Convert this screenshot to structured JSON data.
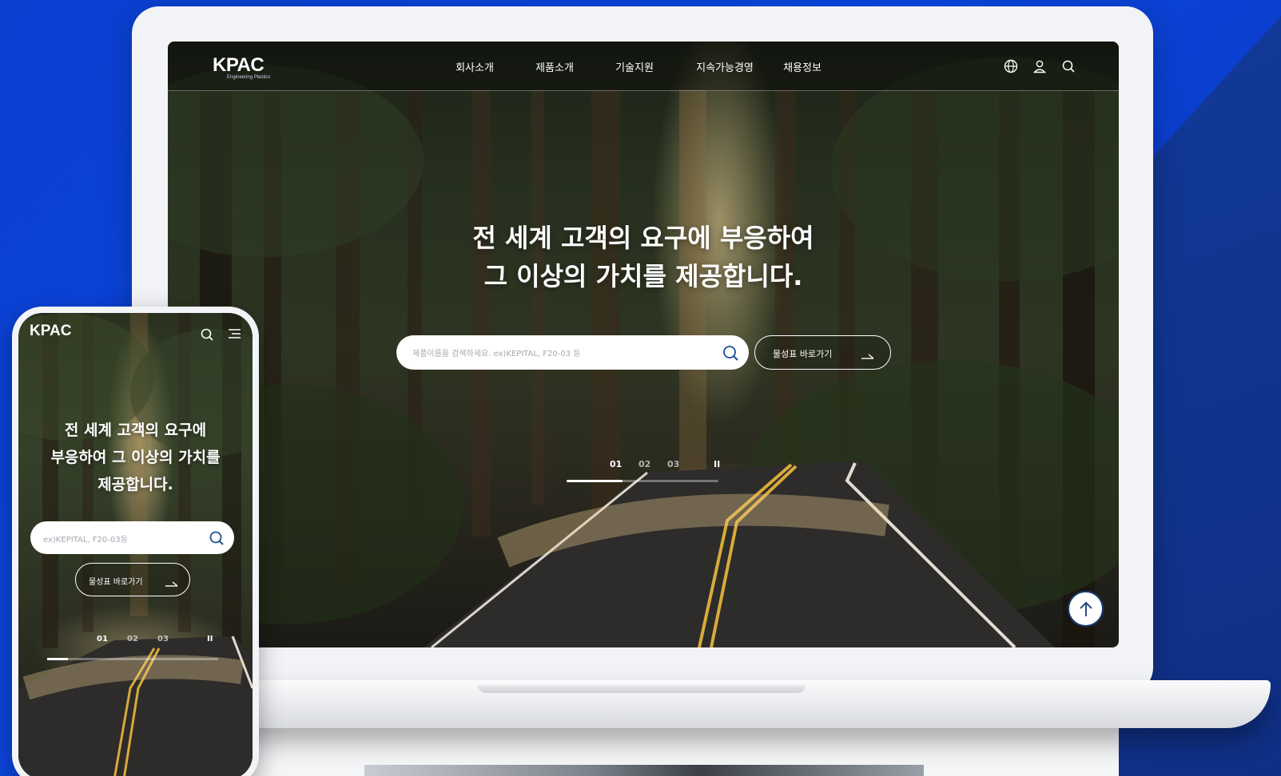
{
  "desktop": {
    "logo": {
      "mark": "KPAC",
      "tagline": "Engineering Plastics"
    },
    "nav": {
      "items": [
        {
          "label": "회사소개"
        },
        {
          "label": "제품소개"
        },
        {
          "label": "기술지원"
        },
        {
          "label": "지속가능경영"
        },
        {
          "label": "채용정보"
        }
      ],
      "icons": [
        "globe-icon",
        "user-icon",
        "search-icon"
      ]
    },
    "hero": {
      "title_line1": "전 세계 고객의 요구에 부응하여",
      "title_line2": "그 이상의 가치를 제공합니다."
    },
    "search": {
      "placeholder": "제품이름을 검색하세요.  ex)KEPITAL, F20-03 등"
    },
    "property_button": {
      "label": "물성표 바로가기"
    },
    "pager": {
      "slides": [
        "01",
        "02",
        "03"
      ],
      "active": "01",
      "pause_symbol": "II",
      "progress": 0.37
    },
    "to_top": {
      "icon": "arrow-up-icon"
    }
  },
  "mobile": {
    "logo": {
      "mark": "KPAC"
    },
    "hero": {
      "title_line1": "전 세계 고객의 요구에",
      "title_line2": "부응하여 그 이상의 가치를",
      "title_line3": "제공합니다."
    },
    "search": {
      "placeholder": "ex)KEPITAL, F20-03등"
    },
    "property_button": {
      "label": "물성표 바로가기"
    },
    "pager": {
      "slides": [
        "01",
        "02",
        "03"
      ],
      "active": "01",
      "pause_symbol": "II",
      "progress": 0.12
    }
  },
  "colors": {
    "background_blue": "#0b47e0",
    "accent_navy": "#17396f",
    "search_icon": "#1d4f91"
  }
}
